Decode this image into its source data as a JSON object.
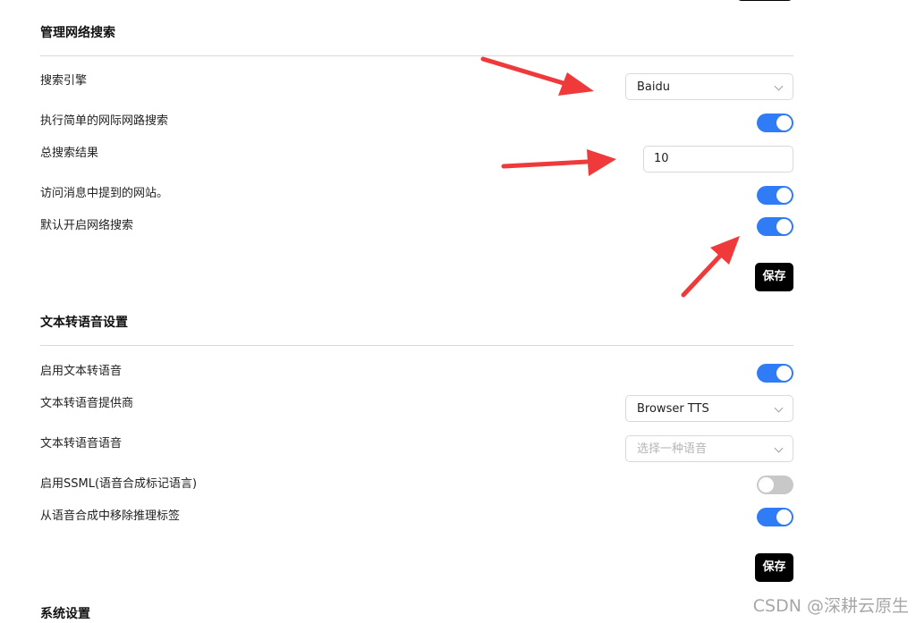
{
  "web_search": {
    "title": "管理网络搜索",
    "engine_label": "搜索引擎",
    "engine_value": "Baidu",
    "simple_search_label": "执行简单的网际网路搜索",
    "simple_search_enabled": true,
    "total_results_label": "总搜索结果",
    "total_results_value": "10",
    "visit_sites_label": "访问消息中提到的网站。",
    "visit_sites_enabled": true,
    "default_on_label": "默认开启网络搜索",
    "default_on_enabled": true,
    "save_label": "保存"
  },
  "tts": {
    "title": "文本转语音设置",
    "enable_label": "启用文本转语音",
    "enable_enabled": true,
    "provider_label": "文本转语音提供商",
    "provider_value": "Browser TTS",
    "voice_label": "文本转语音语音",
    "voice_placeholder": "选择一种语音",
    "ssml_label": "启用SSML(语音合成标记语言)",
    "ssml_enabled": false,
    "remove_tags_label": "从语音合成中移除推理标签",
    "remove_tags_enabled": true,
    "save_label": "保存"
  },
  "system": {
    "title": "系统设置"
  },
  "watermark": "CSDN @深耕云原生",
  "colors": {
    "accent": "#2f7cf6",
    "toggle_off": "#c8c8c8",
    "arrow": "#f0393a",
    "button": "#000000"
  }
}
